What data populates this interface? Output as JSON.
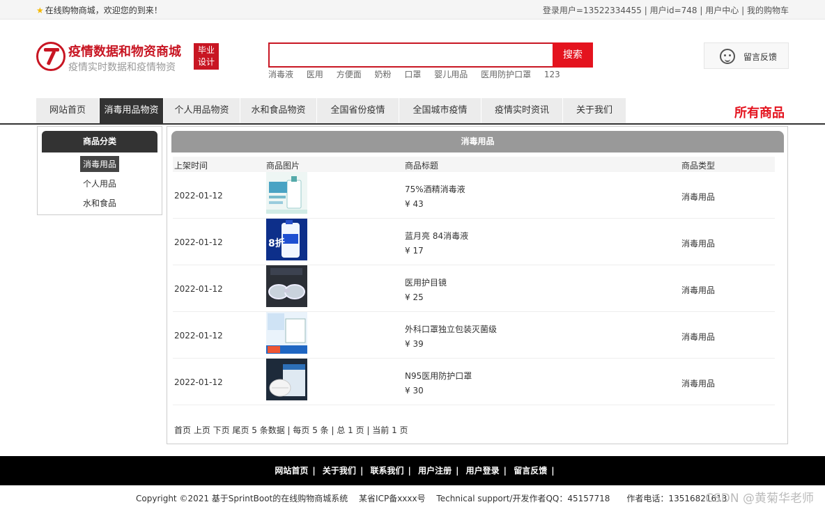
{
  "topbar": {
    "welcome": "在线购物商城，欢迎您的到来！",
    "login_user": "登录用户=13522334455",
    "user_id": "用户id=748",
    "user_center": "用户中心",
    "my_cart": "我的购物车",
    "sep": "|"
  },
  "logo": {
    "title": "疫情数据和物资商城",
    "subtitle": "疫情实时数据和疫情物资",
    "badge_line1": "毕业",
    "badge_line2": "设计"
  },
  "search": {
    "value": "",
    "button": "搜索",
    "hotwords": [
      "消毒液",
      "医用",
      "方便面",
      "奶粉",
      "口罩",
      "婴儿用品",
      "医用防护口罩",
      "123"
    ]
  },
  "feedback": {
    "label": "留言反馈",
    "icon": "customer-service-icon"
  },
  "nav": {
    "items": [
      "网站首页",
      "消毒用品物资",
      "个人用品物资",
      "水和食品物资",
      "全国省份疫情",
      "全国城市疫情",
      "疫情实时资讯",
      "关于我们"
    ],
    "active": 1,
    "all_goods": "所有商品"
  },
  "sidebar": {
    "title": "商品分类",
    "items": [
      "消毒用品",
      "个人用品",
      "水和食品"
    ],
    "active": 0
  },
  "main": {
    "title": "消毒用品",
    "columns": [
      "上架时间",
      "商品图片",
      "商品标题",
      "商品类型"
    ],
    "rows": [
      {
        "date": "2022-01-12",
        "title": "75%酒精消毒液",
        "price": "¥ 43",
        "type": "消毒用品",
        "image": "alcohol-bottle-image"
      },
      {
        "date": "2022-01-12",
        "title": "蓝月亮 84消毒液",
        "price": "¥ 17",
        "type": "消毒用品",
        "image": "84-disinfectant-image"
      },
      {
        "date": "2022-01-12",
        "title": "医用护目镜",
        "price": "¥ 25",
        "type": "消毒用品",
        "image": "goggles-image"
      },
      {
        "date": "2022-01-12",
        "title": "外科口罩独立包装灭菌级",
        "price": "¥ 39",
        "type": "消毒用品",
        "image": "surgical-mask-image"
      },
      {
        "date": "2022-01-12",
        "title": "N95医用防护口罩",
        "price": "¥ 30",
        "type": "消毒用品",
        "image": "n95-mask-image"
      }
    ],
    "pager": "首页 上页 下页 尾页 5 条数据 | 每页 5 条 | 总 1 页 | 当前 1 页"
  },
  "footer": {
    "links": [
      "网站首页",
      "关于我们",
      "联系我们",
      "用户注册",
      "用户登录",
      "留言反馈"
    ],
    "copyright": "Copyright ©2021 基于SprintBoot的在线购物商城系统　 某省ICP备xxxx号　 Technical support/开发作者QQ：45157718　　作者电话：13516821613",
    "watermark": "CSDN @黄菊华老师"
  },
  "colors": {
    "brand_red": "#c81623",
    "button_red": "#e4131e",
    "nav_active": "#333333"
  }
}
